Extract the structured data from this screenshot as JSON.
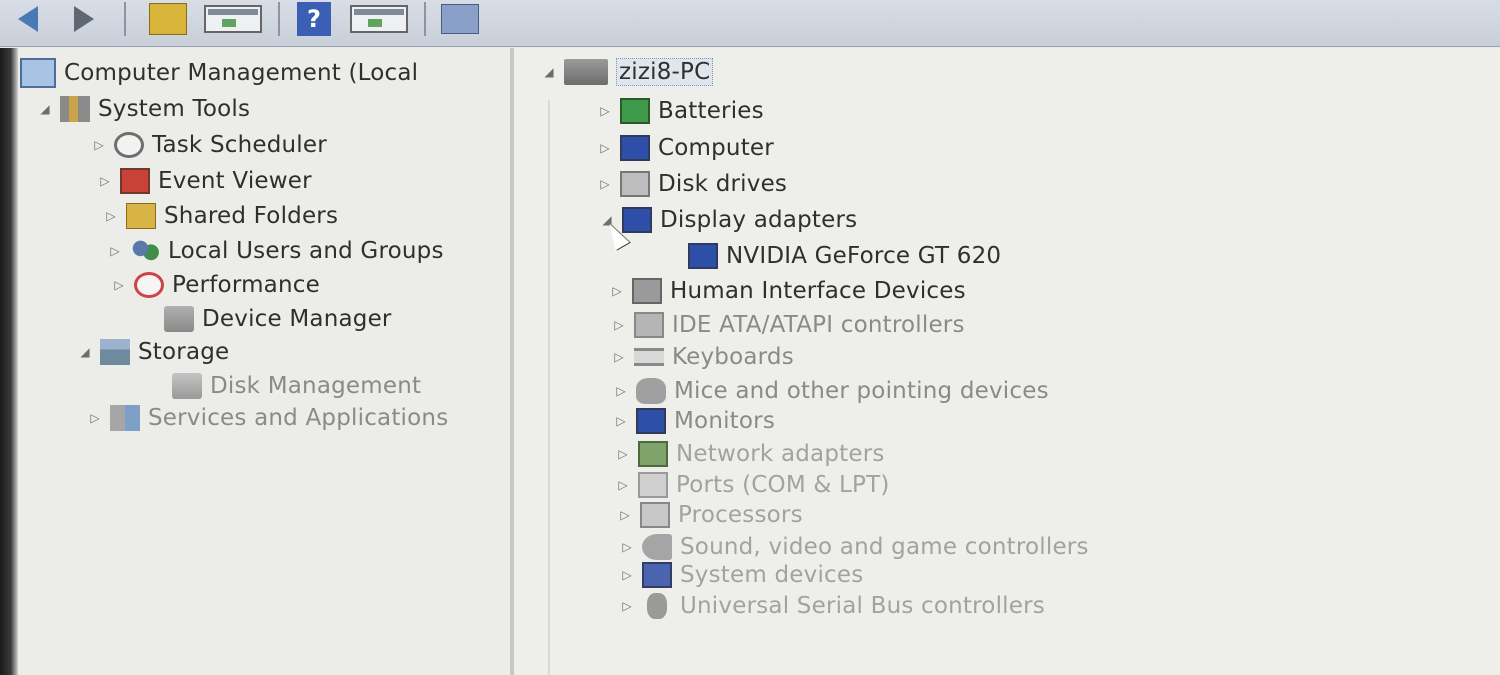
{
  "toolbar": {
    "items": [
      {
        "name": "back-arrow-icon"
      },
      {
        "name": "forward-arrow-icon"
      },
      {
        "name": "up-folder-icon"
      },
      {
        "name": "show-hide-console-tree-icon"
      },
      {
        "name": "help-icon",
        "glyph": "?"
      },
      {
        "name": "show-hide-action-pane-icon"
      },
      {
        "name": "device-properties-icon"
      }
    ]
  },
  "left_tree": {
    "root": "Computer Management (Local",
    "items": [
      {
        "label": "System Tools",
        "expander": "◢",
        "icon": "tools-icon"
      },
      {
        "label": "Task Scheduler",
        "expander": "▷",
        "icon": "clock-icon"
      },
      {
        "label": "Event Viewer",
        "expander": "▷",
        "icon": "event-viewer-icon"
      },
      {
        "label": "Shared Folders",
        "expander": "▷",
        "icon": "shared-folder-icon"
      },
      {
        "label": "Local Users and Groups",
        "expander": "▷",
        "icon": "users-icon"
      },
      {
        "label": "Performance",
        "expander": "▷",
        "icon": "performance-icon"
      },
      {
        "label": "Device Manager",
        "expander": "",
        "icon": "device-manager-icon"
      },
      {
        "label": "Storage",
        "expander": "◢",
        "icon": "storage-icon"
      },
      {
        "label": "Disk Management",
        "expander": "",
        "icon": "disk-icon"
      },
      {
        "label": "Services and Applications",
        "expander": "▷",
        "icon": "services-icon"
      }
    ]
  },
  "device_tree": {
    "root": "zizi8-PC",
    "root_expander": "◢",
    "items": [
      {
        "label": "Batteries",
        "expander": "▷",
        "icon": "battery-icon"
      },
      {
        "label": "Computer",
        "expander": "▷",
        "icon": "computer-icon"
      },
      {
        "label": "Disk drives",
        "expander": "▷",
        "icon": "disk-drive-icon"
      },
      {
        "label": "Display adapters",
        "expander": "◢",
        "icon": "display-adapter-icon"
      },
      {
        "label": "NVIDIA GeForce GT 620",
        "expander": "",
        "icon": "display-adapter-icon"
      },
      {
        "label": "Human Interface Devices",
        "expander": "▷",
        "icon": "hid-icon"
      },
      {
        "label": "IDE ATA/ATAPI controllers",
        "expander": "▷",
        "icon": "ide-controller-icon"
      },
      {
        "label": "Keyboards",
        "expander": "▷",
        "icon": "keyboard-icon"
      },
      {
        "label": "Mice and other pointing devices",
        "expander": "▷",
        "icon": "mouse-icon"
      },
      {
        "label": "Monitors",
        "expander": "▷",
        "icon": "monitor-icon"
      },
      {
        "label": "Network adapters",
        "expander": "▷",
        "icon": "network-adapter-icon"
      },
      {
        "label": "Ports (COM & LPT)",
        "expander": "▷",
        "icon": "port-icon"
      },
      {
        "label": "Processors",
        "expander": "▷",
        "icon": "processor-icon"
      },
      {
        "label": "Sound, video and game controllers",
        "expander": "▷",
        "icon": "sound-icon"
      },
      {
        "label": "System devices",
        "expander": "▷",
        "icon": "system-device-icon"
      },
      {
        "label": "Universal Serial Bus controllers",
        "expander": "▷",
        "icon": "usb-icon"
      }
    ]
  },
  "colors": {
    "toolbar": "#cfd5de",
    "pane": "#ecece9",
    "text": "#2f2f2f",
    "accent": "#3a5fb5"
  }
}
